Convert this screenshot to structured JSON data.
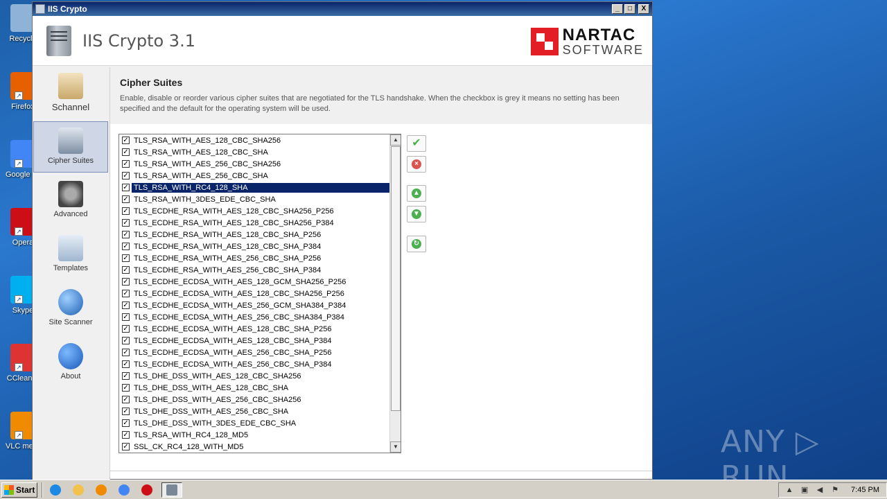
{
  "window": {
    "title": "IIS Crypto",
    "app_title": "IIS Crypto 3.1",
    "logo_line1": "NARTAC",
    "logo_line2": "SOFTWARE",
    "controls": {
      "minimize": "_",
      "maximize": "□",
      "close": "X"
    }
  },
  "sidebar": {
    "items": [
      {
        "label": "Schannel",
        "icon": "schannel-icon",
        "active": false
      },
      {
        "label": "Cipher Suites",
        "icon": "lock-icon",
        "active": true
      },
      {
        "label": "Advanced",
        "icon": "gear-icon",
        "active": false
      },
      {
        "label": "Templates",
        "icon": "templates-icon",
        "active": false
      },
      {
        "label": "Site Scanner",
        "icon": "globe-icon",
        "active": false
      },
      {
        "label": "About",
        "icon": "info-icon",
        "active": false
      }
    ]
  },
  "section": {
    "title": "Cipher Suites",
    "description": "Enable, disable or reorder various cipher suites that are negotiated for the TLS handshake. When the checkbox is grey it means no setting has been specified and the default for the operating system will be used."
  },
  "cipher_suites": [
    {
      "name": "TLS_RSA_WITH_AES_128_CBC_SHA256",
      "checked": true
    },
    {
      "name": "TLS_RSA_WITH_AES_128_CBC_SHA",
      "checked": true
    },
    {
      "name": "TLS_RSA_WITH_AES_256_CBC_SHA256",
      "checked": true
    },
    {
      "name": "TLS_RSA_WITH_AES_256_CBC_SHA",
      "checked": true
    },
    {
      "name": "TLS_RSA_WITH_RC4_128_SHA",
      "checked": true,
      "selected": true
    },
    {
      "name": "TLS_RSA_WITH_3DES_EDE_CBC_SHA",
      "checked": true
    },
    {
      "name": "TLS_ECDHE_RSA_WITH_AES_128_CBC_SHA256_P256",
      "checked": true
    },
    {
      "name": "TLS_ECDHE_RSA_WITH_AES_128_CBC_SHA256_P384",
      "checked": true
    },
    {
      "name": "TLS_ECDHE_RSA_WITH_AES_128_CBC_SHA_P256",
      "checked": true
    },
    {
      "name": "TLS_ECDHE_RSA_WITH_AES_128_CBC_SHA_P384",
      "checked": true
    },
    {
      "name": "TLS_ECDHE_RSA_WITH_AES_256_CBC_SHA_P256",
      "checked": true
    },
    {
      "name": "TLS_ECDHE_RSA_WITH_AES_256_CBC_SHA_P384",
      "checked": true
    },
    {
      "name": "TLS_ECDHE_ECDSA_WITH_AES_128_GCM_SHA256_P256",
      "checked": true
    },
    {
      "name": "TLS_ECDHE_ECDSA_WITH_AES_128_CBC_SHA256_P256",
      "checked": true
    },
    {
      "name": "TLS_ECDHE_ECDSA_WITH_AES_256_GCM_SHA384_P384",
      "checked": true
    },
    {
      "name": "TLS_ECDHE_ECDSA_WITH_AES_256_CBC_SHA384_P384",
      "checked": true
    },
    {
      "name": "TLS_ECDHE_ECDSA_WITH_AES_128_CBC_SHA_P256",
      "checked": true
    },
    {
      "name": "TLS_ECDHE_ECDSA_WITH_AES_128_CBC_SHA_P384",
      "checked": true
    },
    {
      "name": "TLS_ECDHE_ECDSA_WITH_AES_256_CBC_SHA_P256",
      "checked": true
    },
    {
      "name": "TLS_ECDHE_ECDSA_WITH_AES_256_CBC_SHA_P384",
      "checked": true
    },
    {
      "name": "TLS_DHE_DSS_WITH_AES_128_CBC_SHA256",
      "checked": true
    },
    {
      "name": "TLS_DHE_DSS_WITH_AES_128_CBC_SHA",
      "checked": true
    },
    {
      "name": "TLS_DHE_DSS_WITH_AES_256_CBC_SHA256",
      "checked": true
    },
    {
      "name": "TLS_DHE_DSS_WITH_AES_256_CBC_SHA",
      "checked": true
    },
    {
      "name": "TLS_DHE_DSS_WITH_3DES_EDE_CBC_SHA",
      "checked": true
    },
    {
      "name": "TLS_RSA_WITH_RC4_128_MD5",
      "checked": true
    },
    {
      "name": "SSL_CK_RC4_128_WITH_MD5",
      "checked": true
    }
  ],
  "actions": [
    {
      "name": "enable-all-button",
      "icon": "check-icon",
      "glyph": "✔",
      "color": "#4caf50"
    },
    {
      "name": "disable-all-button",
      "icon": "x-icon",
      "glyph": "×",
      "color": "#d9534f"
    },
    {
      "name": "move-up-button",
      "icon": "arrow-up-icon",
      "glyph": "▲",
      "color": "#4caf50"
    },
    {
      "name": "move-down-button",
      "icon": "arrow-down-icon",
      "glyph": "▼",
      "color": "#4caf50"
    },
    {
      "name": "reset-button",
      "icon": "refresh-icon",
      "glyph": "↻",
      "color": "#4caf50"
    }
  ],
  "desktop": {
    "icons": [
      {
        "label": "Recycle",
        "icon": "recycle-bin-icon",
        "color": "#8fb3d6"
      },
      {
        "label": "Firefox",
        "icon": "firefox-icon",
        "color": "#e66000"
      },
      {
        "label": "Google Chrome",
        "icon": "chrome-icon",
        "color": "#4285f4"
      },
      {
        "label": "Opera",
        "icon": "opera-icon",
        "color": "#cc0f16"
      },
      {
        "label": "Skype",
        "icon": "skype-icon",
        "color": "#00aff0"
      },
      {
        "label": "CCleaner",
        "icon": "ccleaner-icon",
        "color": "#d33"
      },
      {
        "label": "VLC media player",
        "icon": "vlc-icon",
        "color": "#f08a00"
      }
    ],
    "watermark": "ANY ▷ RUN"
  },
  "taskbar": {
    "start_label": "Start",
    "apps": [
      {
        "name": "ie-taskbar-icon",
        "color": "#1e88e5"
      },
      {
        "name": "explorer-taskbar-icon",
        "color": "#f2c14e"
      },
      {
        "name": "media-player-taskbar-icon",
        "color": "#f08a00"
      },
      {
        "name": "chrome-taskbar-icon",
        "color": "#4285f4"
      },
      {
        "name": "opera-taskbar-icon",
        "color": "#cc0f16"
      },
      {
        "name": "iis-crypto-taskbar-icon",
        "color": "#7a8796",
        "active": true
      }
    ],
    "clock": "7:45 PM"
  }
}
